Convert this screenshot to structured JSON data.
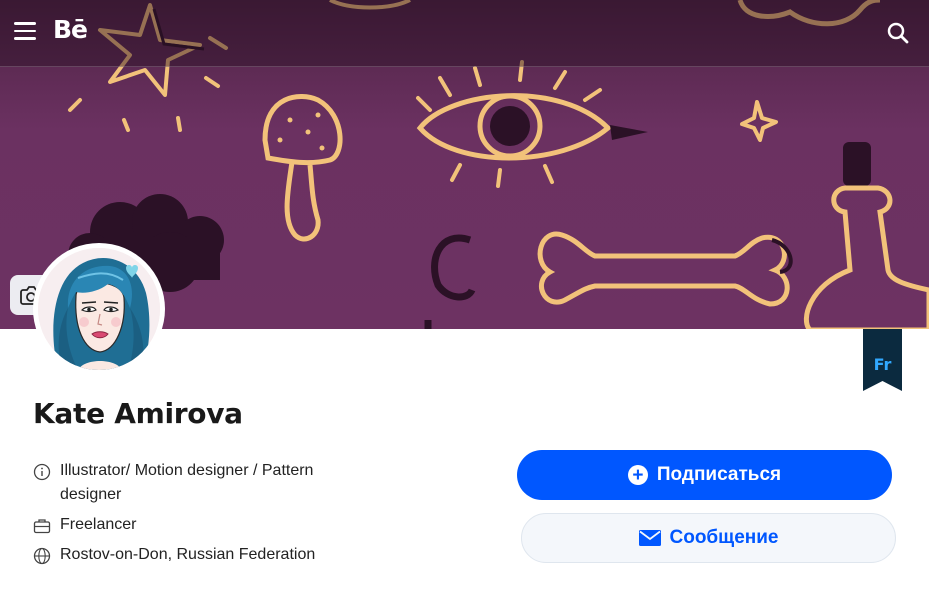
{
  "nav": {
    "logo": "Bē",
    "menu_icon": "hamburger-menu-icon",
    "search_icon": "search-icon"
  },
  "banner": {
    "edit_icon": "camera-icon",
    "colors": {
      "background": "#6b3161",
      "stroke": "#f2c27a",
      "shadow": "#2b1126"
    }
  },
  "profile": {
    "name": "Kate Amirova",
    "occupation": "Illustrator/ Motion designer / Pattern designer",
    "company": "Freelancer",
    "location": "Rostov-on-Don, Russian Federation",
    "badge": "Fr"
  },
  "actions": {
    "follow_label": "Подписаться",
    "message_label": "Сообщение"
  },
  "colors": {
    "accent": "#0057ff",
    "fresco_badge_bg": "#0b2a3f",
    "fresco_badge_text": "#31a8ff"
  }
}
